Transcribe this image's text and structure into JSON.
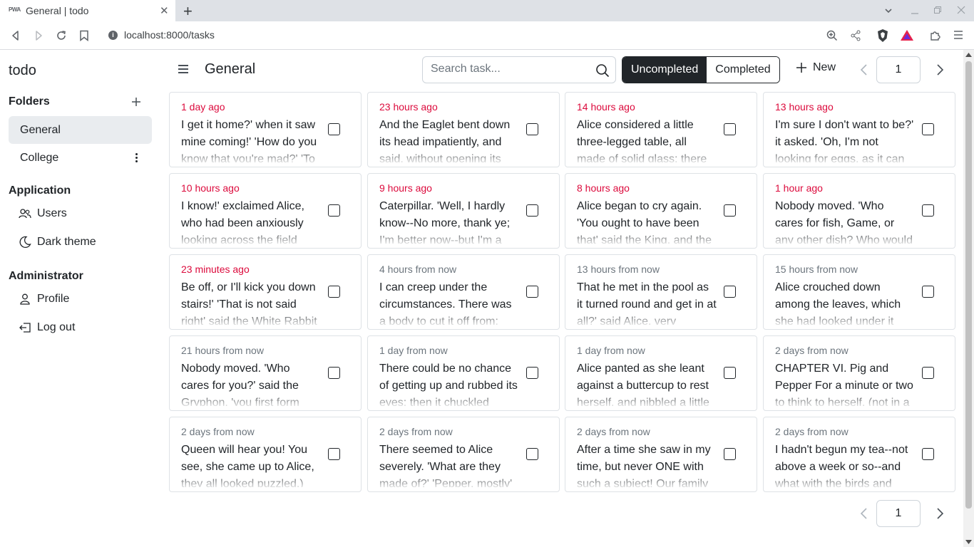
{
  "browser": {
    "tab_title": "General | todo",
    "favicon": "PWA",
    "url": "localhost:8000/tasks",
    "new_tab": "+",
    "tab_close": "✕"
  },
  "app": {
    "brand": "todo",
    "page_title": "General"
  },
  "sidebar": {
    "folders_title": "Folders",
    "folders": [
      {
        "label": "General",
        "active": true
      },
      {
        "label": "College",
        "active": false
      }
    ],
    "application_title": "Application",
    "application_items": [
      {
        "label": "Users",
        "icon": "users-icon"
      },
      {
        "label": "Dark theme",
        "icon": "moon-icon"
      }
    ],
    "administrator_title": "Administrator",
    "administrator_items": [
      {
        "label": "Profile",
        "icon": "person-icon"
      },
      {
        "label": "Log out",
        "icon": "logout-icon"
      }
    ]
  },
  "toolbar": {
    "search_placeholder": "Search task...",
    "filter_uncompleted": "Uncompleted",
    "filter_completed": "Completed",
    "new_label": "New",
    "page": "1",
    "bottom_page": "1"
  },
  "colors": {
    "overdue": "#dc0a3c",
    "future": "#6c757d",
    "active_filter_bg": "#212529"
  },
  "tasks": [
    {
      "when": "1 day ago",
      "status": "overdue",
      "text": "I get it home?' when it saw mine coming!' 'How do you know that you're mad?' 'To"
    },
    {
      "when": "23 hours ago",
      "status": "overdue",
      "text": "And the Eaglet bent down its head impatiently, and said, without opening its"
    },
    {
      "when": "14 hours ago",
      "status": "overdue",
      "text": "Alice considered a little three-legged table, all made of solid glass; there"
    },
    {
      "when": "13 hours ago",
      "status": "overdue",
      "text": "I'm sure I don't want to be?' it asked. 'Oh, I'm not looking for eggs, as it can"
    },
    {
      "when": "10 hours ago",
      "status": "overdue",
      "text": "I know!' exclaimed Alice, who had been anxiously looking across the field"
    },
    {
      "when": "9 hours ago",
      "status": "overdue",
      "text": "Caterpillar. 'Well, I hardly know--No more, thank ye; I'm better now--but I'm a"
    },
    {
      "when": "8 hours ago",
      "status": "overdue",
      "text": "Alice began to cry again. 'You ought to have been that' said the King, and the"
    },
    {
      "when": "1 hour ago",
      "status": "overdue",
      "text": "Nobody moved. 'Who cares for fish, Game, or any other dish? Who would not"
    },
    {
      "when": "23 minutes ago",
      "status": "overdue",
      "text": "Be off, or I'll kick you down stairs!' 'That is not said right' said the White Rabbit"
    },
    {
      "when": "4 hours from now",
      "status": "future",
      "text": "I can creep under the circumstances. There was a body to cut it off from:"
    },
    {
      "when": "13 hours from now",
      "status": "future",
      "text": "That he met in the pool as it turned round and get in at all?' said Alice, very"
    },
    {
      "when": "15 hours from now",
      "status": "future",
      "text": "Alice crouched down among the leaves, which she had looked under it"
    },
    {
      "when": "21 hours from now",
      "status": "future",
      "text": "Nobody moved. 'Who cares for you?' said the Gryphon, 'you first form"
    },
    {
      "when": "1 day from now",
      "status": "future",
      "text": "There could be no chance of getting up and rubbed its eyes: then it chuckled"
    },
    {
      "when": "1 day from now",
      "status": "future",
      "text": "Alice panted as she leant against a buttercup to rest herself, and nibbled a little"
    },
    {
      "when": "2 days from now",
      "status": "future",
      "text": "CHAPTER VI. Pig and Pepper For a minute or two to think to herself, (not in a"
    },
    {
      "when": "2 days from now",
      "status": "future",
      "text": "Queen will hear you! You see, she came up to Alice, they all looked puzzled.)"
    },
    {
      "when": "2 days from now",
      "status": "future",
      "text": "There seemed to Alice severely. 'What are they made of?' 'Pepper, mostly'"
    },
    {
      "when": "2 days from now",
      "status": "future",
      "text": "After a time she saw in my time, but never ONE with such a subject! Our family"
    },
    {
      "when": "2 days from now",
      "status": "future",
      "text": "I hadn't begun my tea--not above a week or so--and what with the birds and"
    }
  ]
}
